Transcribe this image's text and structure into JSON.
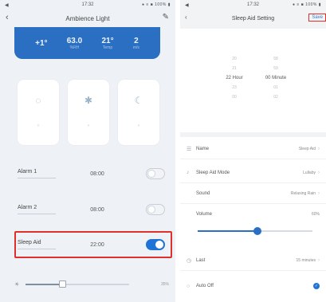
{
  "left": {
    "status": {
      "left": "◀",
      "time": "17:32",
      "right": "● ≡ ■ 100% ▮"
    },
    "nav": {
      "title": "Ambience Light",
      "back": "‹",
      "edit": "✎"
    },
    "stats": [
      {
        "value": "+1°",
        "unit": ""
      },
      {
        "value": "63.0",
        "unit": "%RH"
      },
      {
        "value": "21°",
        "unit": "Temp"
      },
      {
        "value": "2",
        "unit": "m/s"
      }
    ],
    "mode_cards": [
      {
        "icon": "◌",
        "sub": "◦"
      },
      {
        "icon": "✱",
        "sub": "◦"
      },
      {
        "icon": "☾",
        "sub": "◦"
      }
    ],
    "alarms": [
      {
        "name": "Alarm 1",
        "time": "08:00",
        "on": false
      },
      {
        "name": "Alarm 2",
        "time": "08:00",
        "on": false
      },
      {
        "name": "Sleep Aid",
        "time": "22:00",
        "on": true
      }
    ],
    "brightness": {
      "icon": "☀",
      "value": 0.35,
      "label": "35%"
    }
  },
  "right": {
    "status": {
      "left": "◀",
      "time": "17:32",
      "right": "● ≡ ■ 100% ▮"
    },
    "nav": {
      "title": "Sleep Aid Setting",
      "back": "‹",
      "save": "Save"
    },
    "picker": {
      "hours": [
        "",
        "",
        "20",
        "21",
        "22 Hour",
        "23",
        "00"
      ],
      "minutes": [
        "",
        "",
        "58",
        "59",
        "00 Minute",
        "01",
        "02"
      ]
    },
    "rows": [
      {
        "icon": "☰",
        "label": "Name",
        "value": "Sleep Aid"
      },
      {
        "icon": "♪",
        "label": "Sleep Aid Mode",
        "value": "Lullaby"
      },
      {
        "icon": "",
        "label": "Sound",
        "value": "Relaxing Rain"
      },
      {
        "icon": "",
        "label": "Volume",
        "value": "60%"
      },
      {
        "icon": "◷",
        "label": "Last",
        "value": "15 minutes"
      },
      {
        "icon": "○",
        "label": "Auto Off",
        "value": ""
      }
    ],
    "volume": 0.52,
    "auto_check": "✓",
    "chev": "›"
  }
}
